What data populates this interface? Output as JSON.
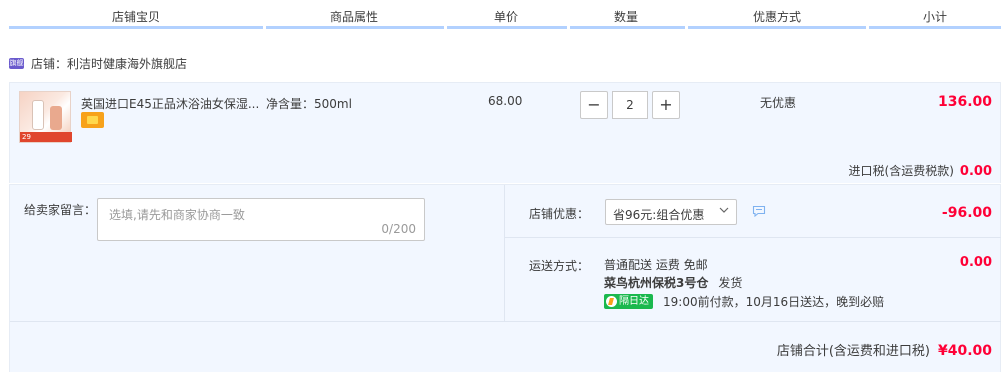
{
  "header": {
    "columns": [
      "店铺宝贝",
      "商品属性",
      "单价",
      "数量",
      "优惠方式",
      "小计"
    ]
  },
  "shop": {
    "badge": "旗舰",
    "label": "店铺：利洁时健康海外旗舰店"
  },
  "item": {
    "title": "英国进口E45正品沐浴油女保湿...",
    "thumb_sale": "29",
    "attribute": "净含量：500ml",
    "price": "68.00",
    "quantity": "2",
    "qty_minus": "−",
    "qty_plus": "+",
    "discount": "无优惠",
    "subtotal": "136.00"
  },
  "tax": {
    "label": "进口税(含运费税款)",
    "amount": "0.00"
  },
  "message": {
    "label": "给卖家留言：",
    "placeholder": "选填,请先和商家协商一致",
    "counter": "0/200"
  },
  "coupon": {
    "label": "店铺优惠：",
    "selected": "省96元:组合优惠",
    "amount": "-96.00"
  },
  "shipping": {
    "label": "运送方式：",
    "line1": "普通配送 运费 免邮",
    "warehouse": "菜鸟杭州保税3号仓",
    "dispatch": "发货",
    "badge": "隔日达",
    "promise": "19:00前付款，10月16日送达，晚到必赔",
    "amount": "0.00"
  },
  "total": {
    "label": "店铺合计(含运费和进口税)",
    "amount": "¥40.00"
  },
  "colors": {
    "accent_red": "#ff0036",
    "header_underline": "#b2d1ff",
    "panel_bg": "#f2f7ff",
    "next_day_green": "#1ab84e"
  }
}
